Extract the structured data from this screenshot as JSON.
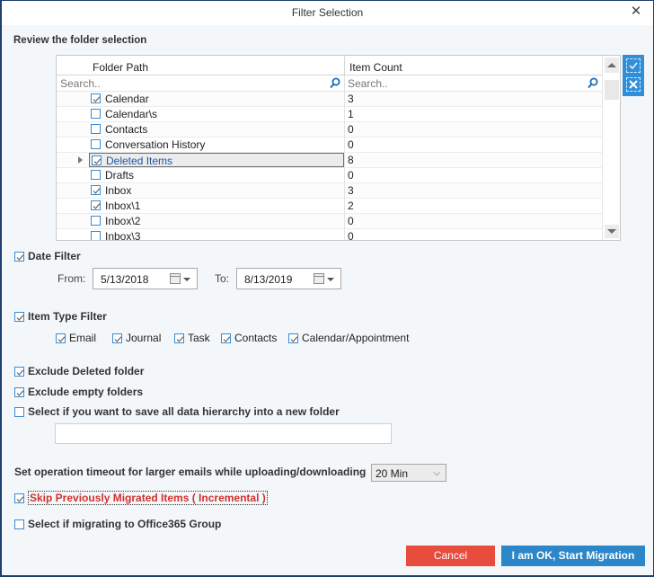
{
  "window": {
    "title": "Filter Selection",
    "close_icon": "close-icon"
  },
  "folder_section": {
    "label": "Review the folder selection",
    "columns": {
      "path": "Folder Path",
      "count": "Item Count"
    },
    "search": {
      "path_placeholder": "Search..",
      "count_placeholder": "Search.."
    },
    "rows": [
      {
        "name": "Calendar",
        "count": "3",
        "checked": true
      },
      {
        "name": "Calendar\\s",
        "count": "1",
        "checked": false
      },
      {
        "name": "Contacts",
        "count": "0",
        "checked": false
      },
      {
        "name": "Conversation History",
        "count": "0",
        "checked": false
      },
      {
        "name": "Deleted Items",
        "count": "8",
        "checked": true,
        "selected": true
      },
      {
        "name": "Drafts",
        "count": "0",
        "checked": false
      },
      {
        "name": "Inbox",
        "count": "3",
        "checked": true
      },
      {
        "name": "Inbox\\1",
        "count": "2",
        "checked": true
      },
      {
        "name": "Inbox\\2",
        "count": "0",
        "checked": false
      },
      {
        "name": "Inbox\\3",
        "count": "0",
        "checked": false
      }
    ],
    "tools": {
      "select_all": "select-all-icon",
      "deselect_all": "deselect-all-icon"
    }
  },
  "date_filter": {
    "label": "Date Filter",
    "checked": true,
    "from_label": "From:",
    "from_value": "5/13/2018",
    "to_label": "To:",
    "to_value": "8/13/2019"
  },
  "item_type_filter": {
    "label": "Item Type Filter",
    "checked": true,
    "types": [
      {
        "label": "Email",
        "checked": true
      },
      {
        "label": "Journal",
        "checked": true
      },
      {
        "label": "Task",
        "checked": true
      },
      {
        "label": "Contacts",
        "checked": true
      },
      {
        "label": "Calendar/Appointment",
        "checked": true
      }
    ]
  },
  "options": {
    "exclude_deleted": {
      "label": "Exclude Deleted folder",
      "checked": true
    },
    "exclude_empty": {
      "label": "Exclude empty folders",
      "checked": true
    },
    "save_hierarchy": {
      "label": "Select if you want to save all data hierarchy into a new folder",
      "checked": false,
      "folder_name_value": ""
    },
    "timeout": {
      "label": "Set operation timeout for larger emails while uploading/downloading",
      "selected": "20 Min"
    },
    "skip_migrated": {
      "label": "Skip Previously Migrated Items ( Incremental )",
      "checked": true
    },
    "office365_group": {
      "label": "Select if migrating to Office365 Group",
      "checked": false
    }
  },
  "buttons": {
    "cancel": "Cancel",
    "start": "I am OK, Start Migration"
  },
  "colors": {
    "accent": "#2b87c9",
    "cancel": "#e84c3d",
    "warning_text": "#d0312d",
    "frame_border": "#1f3f6e"
  }
}
